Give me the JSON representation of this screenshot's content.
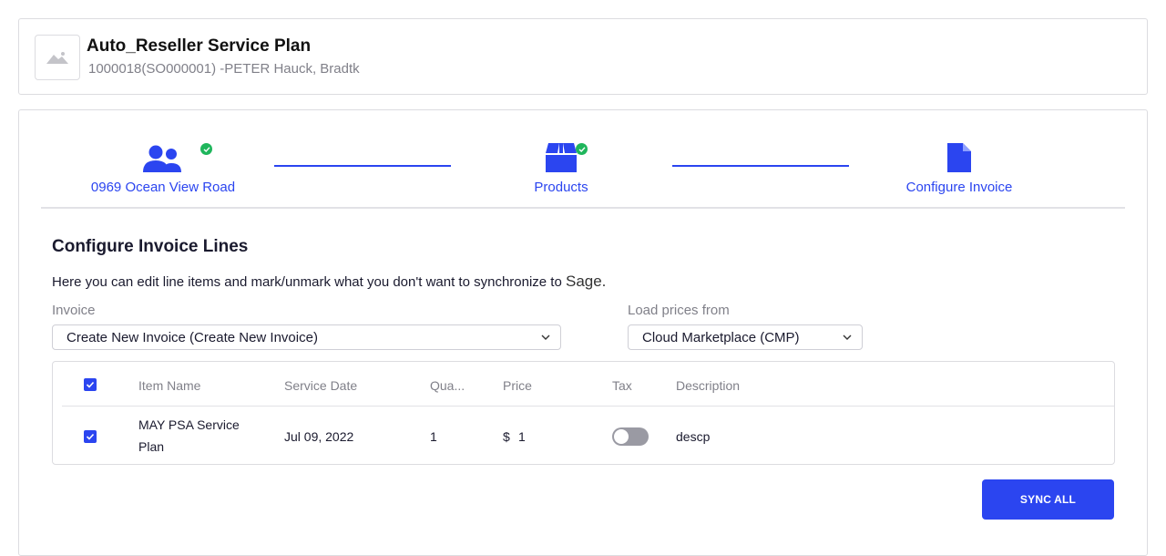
{
  "header": {
    "title": "Auto_Reseller Service Plan",
    "subtitle": "1000018(SO000001) -PETER Hauck, Bradtk"
  },
  "steps": [
    {
      "label": "0969 Ocean View Road",
      "icon": "users-icon",
      "completed": true
    },
    {
      "label": "Products",
      "icon": "box-icon",
      "completed": true
    },
    {
      "label": "Configure Invoice",
      "icon": "document-icon",
      "completed": false
    }
  ],
  "section": {
    "title": "Configure Invoice Lines",
    "description": "Here you can edit line items and mark/unmark what you don't want to synchronize to",
    "target": "Sage."
  },
  "invoice": {
    "label": "Invoice",
    "value": "Create New Invoice (Create New Invoice)"
  },
  "load_prices": {
    "label": "Load prices from",
    "value": "Cloud Marketplace (CMP)"
  },
  "table": {
    "columns": [
      "Item Name",
      "Service Date",
      "Qua...",
      "Price",
      "Tax",
      "Description"
    ],
    "rows": [
      {
        "selected": true,
        "item_name_line1": "MAY PSA Service",
        "item_name_line2": "Plan",
        "service_date": "Jul 09, 2022",
        "quantity": "1",
        "price_currency": "$",
        "price": "1",
        "tax_enabled": false,
        "description": "descp"
      }
    ]
  },
  "actions": {
    "sync_all": "SYNC ALL"
  },
  "colors": {
    "accent": "#2b45f0",
    "success": "#1fb65c",
    "muted_text": "#808089"
  }
}
